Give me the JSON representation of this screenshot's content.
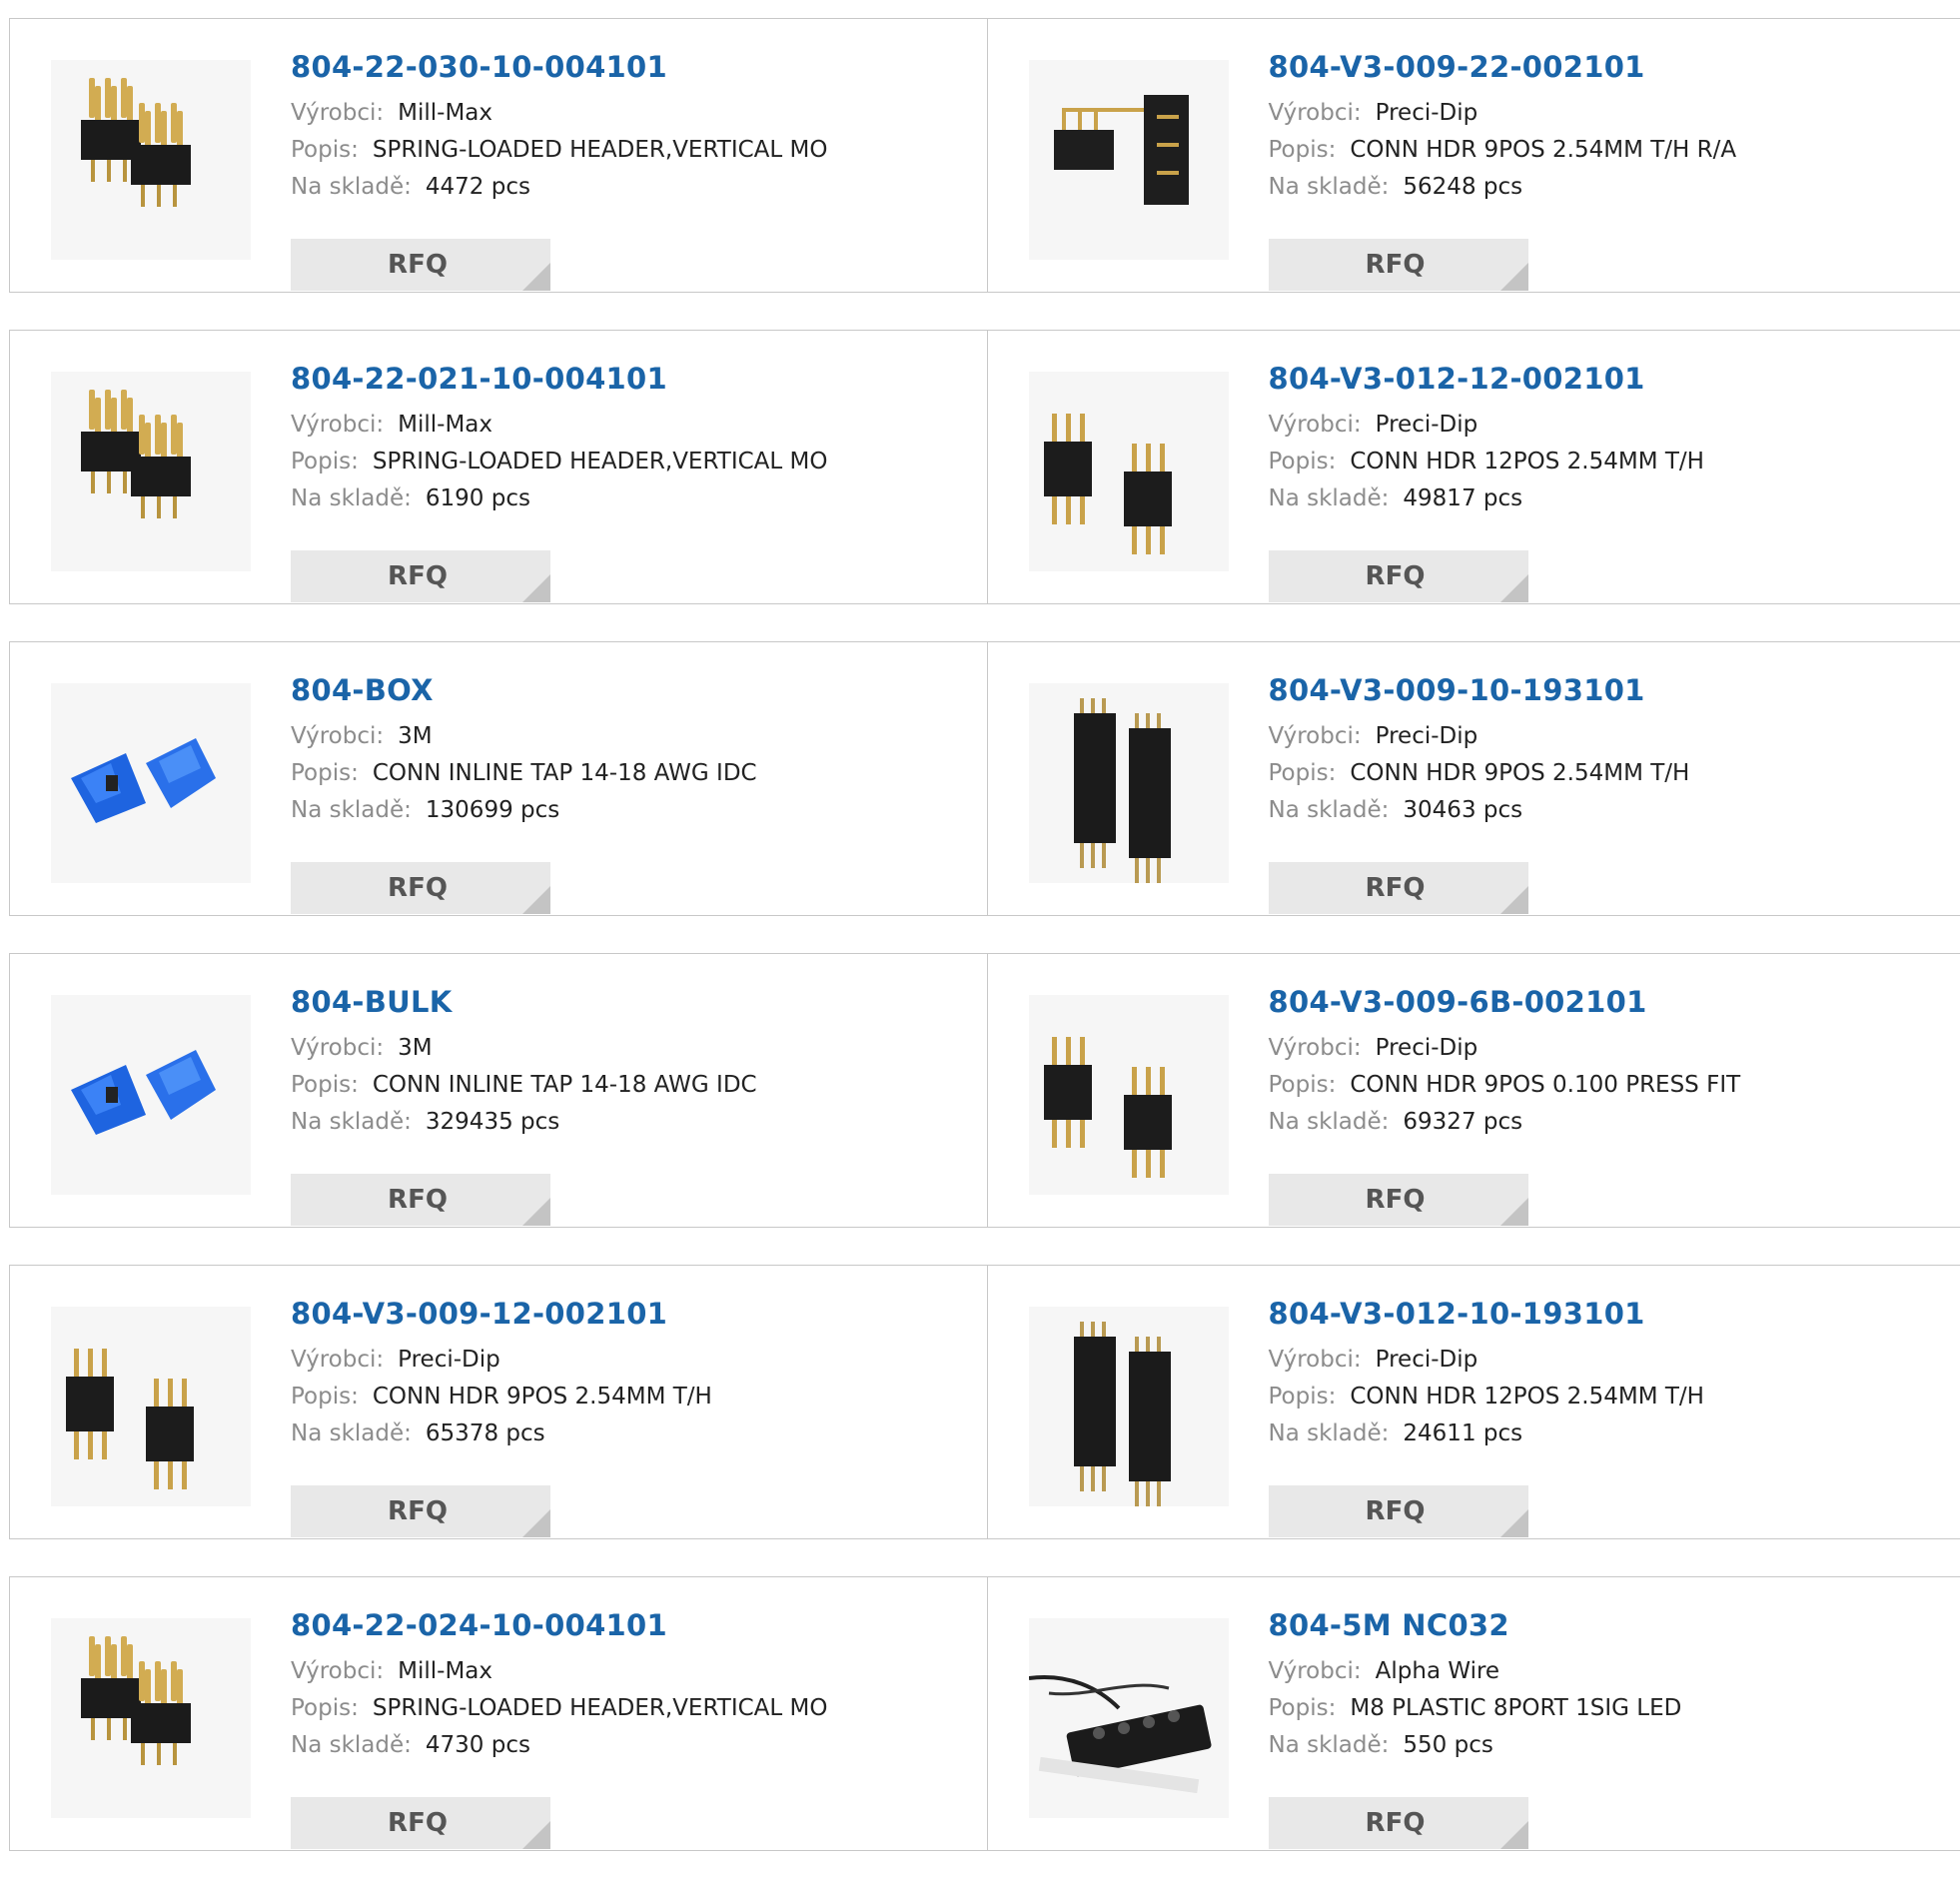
{
  "labels": {
    "maker": "Výrobci:",
    "desc": "Popis:",
    "stock": "Na skladě:",
    "rfq": "RFQ"
  },
  "colors": {
    "part_link": "#1a64a8",
    "label": "#8c8c8c",
    "rfq_bg": "#e8e8e8"
  },
  "rows": [
    [
      {
        "part": "804-22-030-10-004101",
        "maker": "Mill-Max",
        "desc": "SPRING-LOADED HEADER,VERTICAL MO",
        "stock": "4472 pcs",
        "image": "spring-header"
      },
      {
        "part": "804-V3-009-22-002101",
        "maker": "Preci-Dip",
        "desc": "CONN HDR 9POS 2.54MM T/H R/A",
        "stock": "56248 pcs",
        "image": "right-angle-header"
      }
    ],
    [
      {
        "part": "804-22-021-10-004101",
        "maker": "Mill-Max",
        "desc": "SPRING-LOADED HEADER,VERTICAL MO",
        "stock": "6190 pcs",
        "image": "spring-header"
      },
      {
        "part": "804-V3-012-12-002101",
        "maker": "Preci-Dip",
        "desc": "CONN HDR 12POS 2.54MM T/H",
        "stock": "49817 pcs",
        "image": "pin-header"
      }
    ],
    [
      {
        "part": "804-BOX",
        "maker": "3M",
        "desc": "CONN INLINE TAP 14-18 AWG IDC",
        "stock": "130699 pcs",
        "image": "blue-tap"
      },
      {
        "part": "804-V3-009-10-193101",
        "maker": "Preci-Dip",
        "desc": "CONN HDR 9POS 2.54MM T/H",
        "stock": "30463 pcs",
        "image": "tall-header"
      }
    ],
    [
      {
        "part": "804-BULK",
        "maker": "3M",
        "desc": "CONN INLINE TAP 14-18 AWG IDC",
        "stock": "329435 pcs",
        "image": "blue-tap"
      },
      {
        "part": "804-V3-009-6B-002101",
        "maker": "Preci-Dip",
        "desc": "CONN HDR 9POS 0.100 PRESS FIT",
        "stock": "69327 pcs",
        "image": "pin-header"
      }
    ],
    [
      {
        "part": "804-V3-009-12-002101",
        "maker": "Preci-Dip",
        "desc": "CONN HDR 9POS 2.54MM T/H",
        "stock": "65378 pcs",
        "image": "pin-header"
      },
      {
        "part": "804-V3-012-10-193101",
        "maker": "Preci-Dip",
        "desc": "CONN HDR 12POS 2.54MM T/H",
        "stock": "24611 pcs",
        "image": "tall-header"
      }
    ],
    [
      {
        "part": "804-22-024-10-004101",
        "maker": "Mill-Max",
        "desc": "SPRING-LOADED HEADER,VERTICAL MO",
        "stock": "4730 pcs",
        "image": "spring-header"
      },
      {
        "part": "804-5M NC032",
        "maker": "Alpha Wire",
        "desc": "M8 PLASTIC 8PORT 1SIG LED",
        "stock": "550 pcs",
        "image": "m8-block"
      }
    ]
  ]
}
